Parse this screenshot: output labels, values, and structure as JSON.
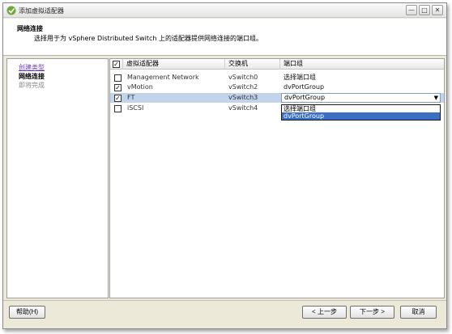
{
  "window": {
    "title": "添加虚拟适配器",
    "controls": [
      "—",
      "□",
      "✕"
    ]
  },
  "header": {
    "title": "网络连接",
    "description": "选择用于为 vSphere Distributed Switch 上的适配器提供网络连接的端口组。"
  },
  "nav": {
    "items": [
      {
        "label": "创建类型",
        "state": "link"
      },
      {
        "label": "网络连接",
        "state": "current"
      },
      {
        "label": "即将完成",
        "state": "future"
      }
    ]
  },
  "grid": {
    "header_checked": true,
    "columns": [
      "虚拟适配器",
      "交换机",
      "端口组"
    ],
    "rows": [
      {
        "checked": false,
        "adapter": "Management Network",
        "switch": "vSwitch0",
        "portgroup": "选择端口组"
      },
      {
        "checked": true,
        "adapter": "vMotion",
        "switch": "vSwitch2",
        "portgroup": "dvPortGroup"
      },
      {
        "checked": true,
        "adapter": "FT",
        "switch": "vSwitch3",
        "portgroup": "dvPortGroup",
        "selected": true
      },
      {
        "checked": false,
        "adapter": "iSCSI",
        "switch": "vSwitch4",
        "portgroup": ""
      }
    ],
    "dropdown_options": [
      "选择端口组",
      "dvPortGroup"
    ],
    "dropdown_highlighted": "dvPortGroup"
  },
  "buttons": {
    "help": "帮助(H)",
    "back": "< 上一步",
    "next": "下一步 >",
    "cancel": "取消"
  },
  "colors": {
    "selection": "#c2d4ec",
    "highlight": "#3a6fc4",
    "nav_link": "#6d3fb5"
  }
}
